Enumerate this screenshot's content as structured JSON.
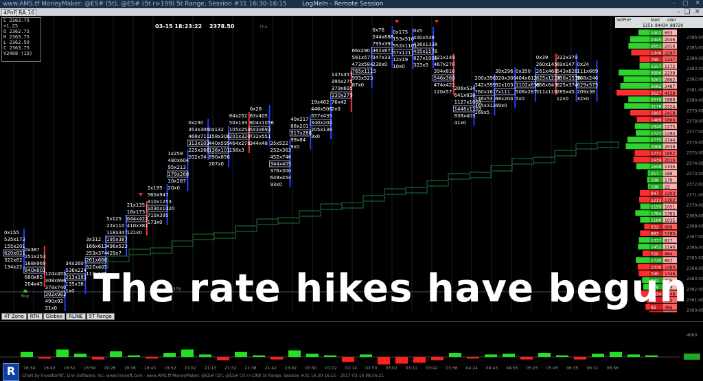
{
  "titlebar": {
    "left": "www.AMS.tf MoneyMaker: @ES# (5t), @ES# (5t r>199) 5t Range, Session #31 16:30-16:15",
    "center": "LogMeIn - Remote Session"
  },
  "toolbar": {
    "period": "4PnF",
    "ra": "RA:16"
  },
  "ohlc": [
    "C  2363.75",
    "   +1.25",
    "O  2362.75",
    "H  2363.75",
    "L  2362.50",
    "C  2363.75",
    "V2408 (19)"
  ],
  "chart": {
    "timestamp": "03-15 18:23:22",
    "price": "2378.50",
    "weekday": "Thu",
    "level_label": "2378"
  },
  "columns": [
    {
      "cells": [
        "0x155",
        "535x173",
        "155x201",
        "620x821",
        "322x62",
        "134x22"
      ]
    },
    {
      "cells": [
        "0x387",
        "251x253",
        "168x969",
        "840x803",
        "680x85",
        "204x45"
      ]
    },
    {
      "cells": [
        "124x455",
        "308x696",
        "379x740",
        "302x982",
        "490x92",
        "21x0"
      ]
    },
    {
      "cells": [
        "34x260",
        "536x224",
        "213x181",
        "135x38",
        "1x0"
      ]
    },
    {
      "cells": [
        "3x312",
        "166x613",
        "253x374",
        "261x666",
        "527x405",
        "113x105"
      ]
    },
    {
      "cells": [
        "5x125",
        "22x110",
        "118x347",
        "195x387",
        "496x523",
        "429x7"
      ]
    },
    {
      "cells": [
        "21x135",
        "18x173",
        "644x422",
        "410x381",
        "121x0"
      ]
    },
    {
      "cells": [
        "2x195",
        "560x947",
        "310x1253",
        "1030x1020",
        "710x395",
        "173x0"
      ]
    },
    {
      "cells": [
        "1x259",
        "480x604",
        "95x213",
        "179x268",
        "10x287",
        "20x0"
      ]
    },
    {
      "cells": [
        "0x230",
        "353x306",
        "468x711",
        "313x103",
        "225x268",
        "202x74"
      ]
    },
    {
      "cells": [
        "0x132",
        "158x308",
        "440x595",
        "136x101",
        "890x856",
        "207x0"
      ]
    },
    {
      "cells": [
        "84x252",
        "50x133",
        "105x254",
        "201x320",
        "464x278",
        "158x3"
      ]
    },
    {
      "cells": [
        "0x28",
        "63x405",
        "804x1056",
        "543x692",
        "732x551",
        "344x48"
      ]
    },
    {
      "cells": [
        "35x522",
        "252x363",
        "452x746",
        "344x405",
        "376x300",
        "649x454",
        "93x0"
      ]
    },
    {
      "cells": [
        "40x217",
        "88x201",
        "517x286",
        "99x84",
        "9x0"
      ]
    },
    {
      "cells": [
        "19x462",
        "446x506",
        "557x435",
        "340x204",
        "205x138",
        "3x0"
      ]
    },
    {
      "cells": [
        "147x357",
        "395x275",
        "379x695",
        "330x279",
        "76x42",
        "2x0"
      ]
    },
    {
      "cells": [
        "66x290",
        "561x577",
        "473x584",
        "765x1115",
        "993x523",
        "87x0"
      ]
    },
    {
      "cells": [
        "0x76",
        "244x688",
        "795x391",
        "462x671",
        "347x33",
        "230x0"
      ]
    },
    {
      "cells": [
        "0x175",
        "153x516",
        "552x1101",
        "57x121",
        "12x19",
        "10x0"
      ]
    },
    {
      "cells": [
        "0x5",
        "400x539",
        "426x1338",
        "405x1576",
        "827x1005",
        "323x5"
      ]
    },
    {
      "cells": [
        "121x149",
        "467x270",
        "394x816",
        "546x360",
        "474x422",
        "120x57"
      ]
    },
    {
      "cells": [
        "206x534",
        "641x838",
        "1127x1069",
        "1446x1103",
        "838x403",
        "41x0"
      ]
    },
    {
      "cells": [
        "200x396",
        "342x599",
        "760x161",
        "146x53",
        "365x312",
        "169x5"
      ]
    },
    {
      "cells": [
        "39x296",
        "320x300",
        "32x103",
        "7x111",
        "68x204",
        "49x0"
      ]
    },
    {
      "cells": [
        "0x350",
        "404x612",
        "1102x636",
        "508x287",
        "5x0"
      ]
    },
    {
      "cells": [
        "0x39",
        "260x145",
        "261x468",
        "825x1224",
        "658x643",
        "511x110"
      ]
    },
    {
      "cells": [
        "222x379",
        "69x147",
        "543x828",
        "390x1536",
        "625x374",
        "285x45",
        "12x0"
      ]
    },
    {
      "cells": [
        "0x24",
        "111x669",
        "568x246",
        "629x575",
        "209x38",
        "32x0"
      ]
    }
  ],
  "price_axis": [
    "2387.00",
    "2386.00",
    "2385.00",
    "2384.00",
    "2383.00",
    "2382.00",
    "2381.00",
    "2380.00",
    "2379.00",
    "2378.00",
    "2377.00",
    "2376.00",
    "2375.00",
    "2374.00",
    "2373.00",
    "2372.00",
    "2371.00",
    "2370.00",
    "2369.00",
    "2368.00",
    "2367.00",
    "2366.00",
    "2365.00",
    "2364.00",
    "2363.00",
    "2362.00",
    "2361.00",
    "2360.00"
  ],
  "volume_profile": {
    "header": [
      "VolPro*",
      "bVol",
      "sVol",
      "125k",
      "84434",
      "88729"
    ],
    "rows": [
      {
        "b": "1402",
        "s": "653"
      },
      {
        "b": "2445",
        "s": "2046"
      },
      {
        "b": "2651",
        "s": "2416"
      },
      {
        "b": "1449",
        "s": "2297"
      },
      {
        "b": "789",
        "s": "1247"
      },
      {
        "b": "1257",
        "s": "1172"
      },
      {
        "b": "3896",
        "s": "2238"
      },
      {
        "b": "3261",
        "s": "2862"
      },
      {
        "b": "3682",
        "s": "3487"
      },
      {
        "b": "3627",
        "s": "4158"
      },
      {
        "b": "2670",
        "s": "1888"
      },
      {
        "b": "3179",
        "s": "2224"
      },
      {
        "b": "1895",
        "s": "2418"
      },
      {
        "b": "1489",
        "s": "1600"
      },
      {
        "b": "1840",
        "s": "1275"
      },
      {
        "b": "1723",
        "s": "1294"
      },
      {
        "b": "2775",
        "s": "2144"
      },
      {
        "b": "2988",
        "s": "2538"
      },
      {
        "b": "1771",
        "s": "1862"
      },
      {
        "b": "1939",
        "s": "2016"
      },
      {
        "b": "1658",
        "s": "1336"
      },
      {
        "b": "217",
        "s": "188"
      },
      {
        "b": "298",
        "s": "179"
      },
      {
        "b": "196",
        "s": "22"
      },
      {
        "b": "947",
        "s": "1203"
      },
      {
        "b": "1213",
        "s": "1302"
      },
      {
        "b": "1155",
        "s": "1051"
      },
      {
        "b": "1784",
        "s": "1385"
      },
      {
        "b": "1180",
        "s": "1035"
      },
      {
        "b": "532",
        "s": "666"
      },
      {
        "b": "883",
        "s": "1185"
      },
      {
        "b": "1337",
        "s": "817"
      },
      {
        "b": "1452",
        "s": "1146"
      },
      {
        "b": "720",
        "s": "864"
      },
      {
        "b": "1720",
        "s": "863"
      },
      {
        "b": "1330",
        "s": "1480"
      },
      {
        "b": "740",
        "s": "1348"
      },
      {
        "b": "922",
        "s": "725"
      },
      {
        "b": "778",
        "s": "514"
      },
      {
        "b": "1034",
        "s": "1048"
      },
      {
        "b": "82",
        "s": "303"
      },
      {
        "b": "92",
        "s": "486"
      },
      {
        "b": "0",
        "s": "21"
      }
    ]
  },
  "time_axis": [
    "16:34",
    "16:43",
    "16:51",
    "16:59",
    "19:26",
    "19:36",
    "19:43",
    "19:52",
    "21:02",
    "21:13",
    "21:32",
    "21:38",
    "21:42",
    "23:02",
    "00:30",
    "01:02",
    "02:14",
    "02:50",
    "03:02",
    "03:11",
    "03:42",
    "03:56",
    "04:24",
    "04:43",
    "04:55",
    "05:25",
    "05:45",
    "06:35",
    "06:31",
    "06:56"
  ],
  "bottom_tabs": [
    "4T Zone",
    "RTH",
    "Globex",
    "RLINE",
    "5T Range"
  ],
  "footer": "Chart by Investor/RT, Linn Software, Inc. www.linnsoft.com - www.AMS.tf MoneyMaker: @ES# (5t), @ES# (5t r>199) 5t Range, Session #31 16:30-16:15 - 2017-03-16 08:56:21",
  "overlay_text": "The rate hikes have begun",
  "buy_label": "Buy",
  "sub_axis_label": "4000",
  "colors": {
    "buy": "#3cd33c",
    "sell": "#ff3333",
    "blue": "#1f3fff",
    "staircase": "#1a7a3a"
  }
}
